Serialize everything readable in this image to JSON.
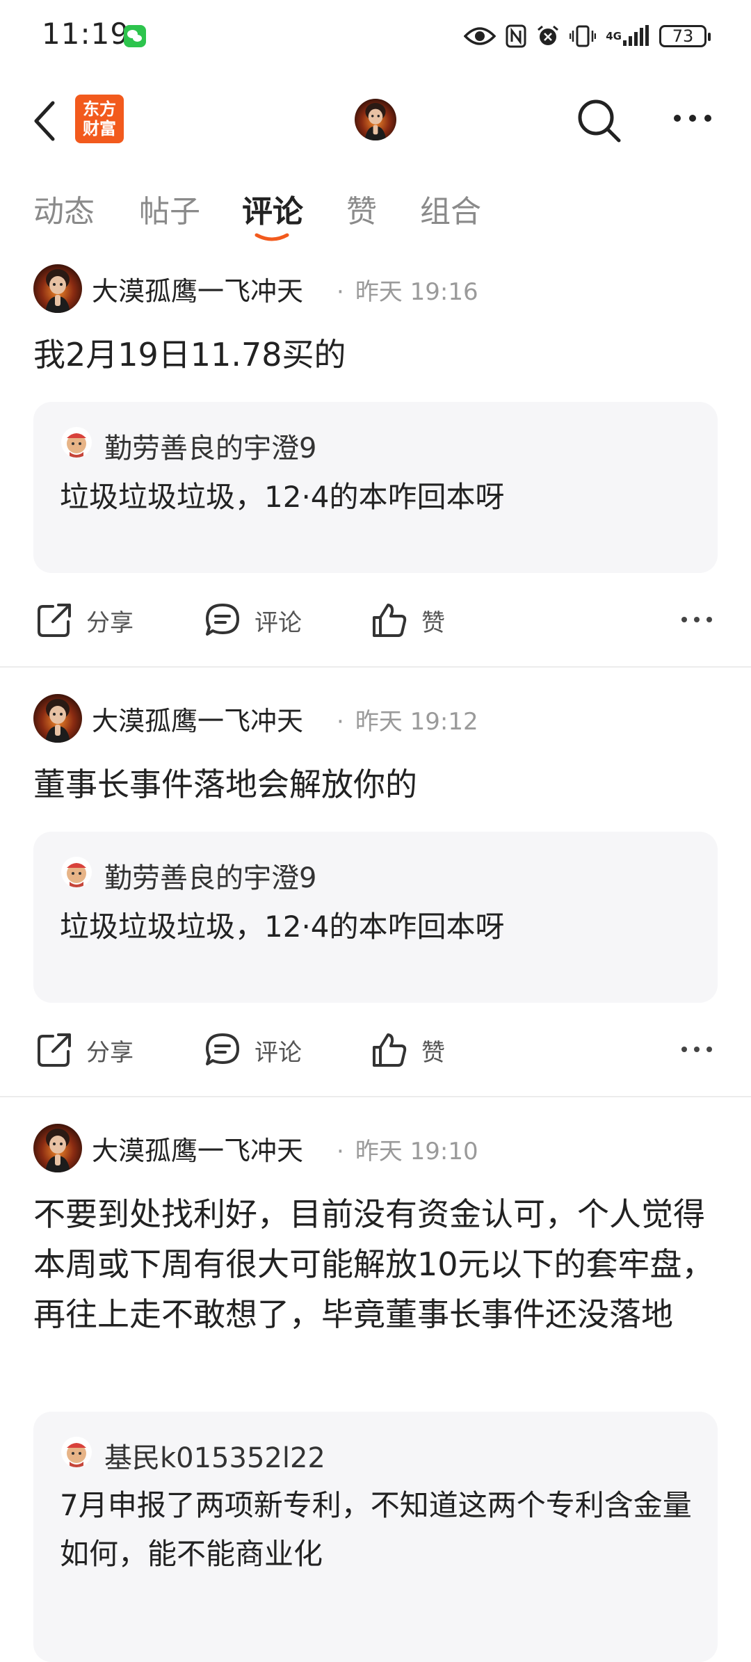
{
  "status_bar": {
    "time": "11:19",
    "battery": "73",
    "network": "4G",
    "icons": [
      "wechat-icon",
      "eye-icon",
      "nfc-icon",
      "alarm-icon",
      "vibrate-icon",
      "signal-icon",
      "battery-icon"
    ]
  },
  "header": {
    "logo_line1": "东方",
    "logo_line2": "财富",
    "logo_color": "#f25a1d",
    "icons": [
      "back-icon",
      "search-icon",
      "more-icon"
    ]
  },
  "tabs": [
    {
      "label": "动态",
      "active": false
    },
    {
      "label": "帖子",
      "active": false
    },
    {
      "label": "评论",
      "active": true
    },
    {
      "label": "赞",
      "active": false
    },
    {
      "label": "组合",
      "active": false
    }
  ],
  "accent_color": "#f25a1d",
  "actions": {
    "share": "分享",
    "comment": "评论",
    "like": "赞"
  },
  "posts": [
    {
      "author": "大漠孤鹰一飞冲天",
      "time": "昨天 19:16",
      "body": "我2月19日11.78买的",
      "quote": {
        "user": "勤劳善良的宇澄9",
        "text": "垃圾垃圾垃圾，12·4的本咋回本呀"
      }
    },
    {
      "author": "大漠孤鹰一飞冲天",
      "time": "昨天 19:12",
      "body": "董事长事件落地会解放你的",
      "quote": {
        "user": "勤劳善良的宇澄9",
        "text": "垃圾垃圾垃圾，12·4的本咋回本呀"
      }
    },
    {
      "author": "大漠孤鹰一飞冲天",
      "time": "昨天 19:10",
      "body": "不要到处找利好，目前没有资金认可，个人觉得本周或下周有很大可能解放10元以下的套牢盘，再往上走不敢想了，毕竟董事长事件还没落地",
      "quote": {
        "user": "基民k015352l22",
        "text": "7月申报了两项新专利，不知道这两个专利含金量如何，能不能商业化"
      }
    }
  ]
}
